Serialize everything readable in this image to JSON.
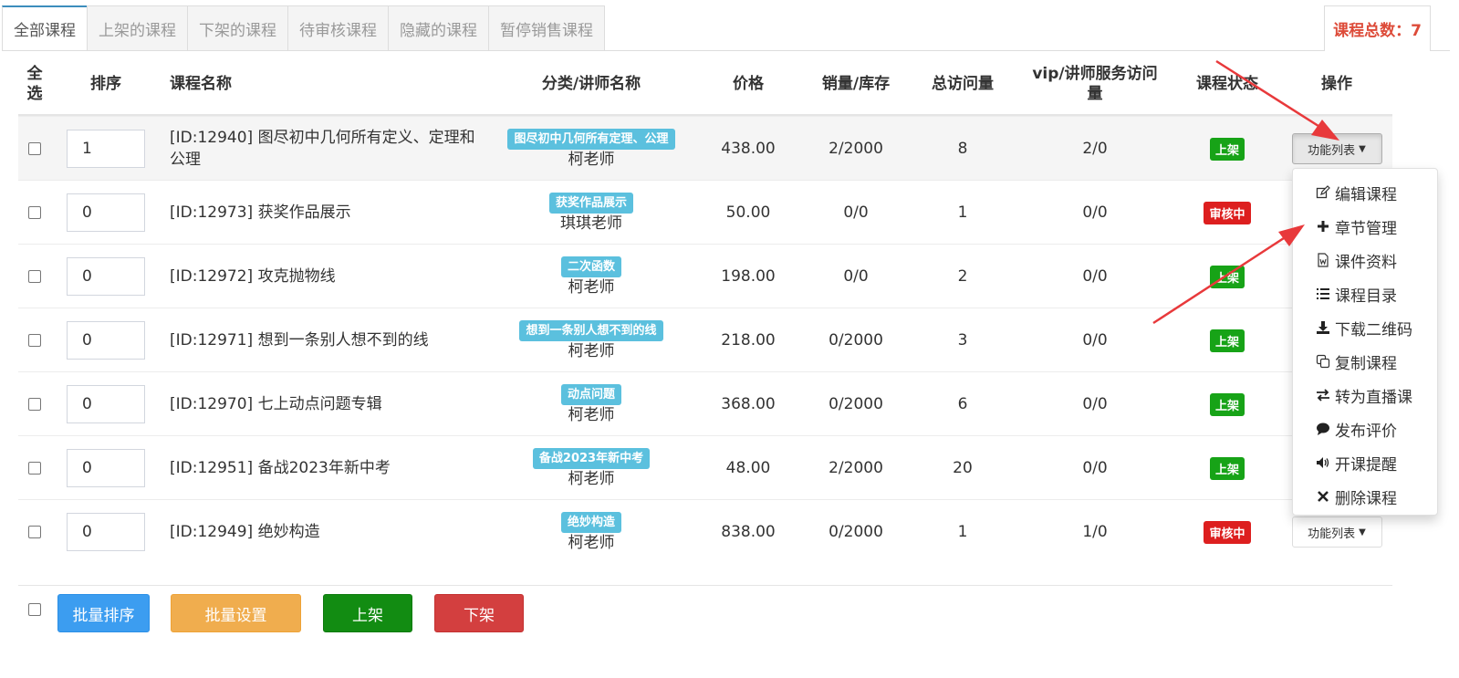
{
  "tabs": [
    "全部课程",
    "上架的课程",
    "下架的课程",
    "待审核课程",
    "隐藏的课程",
    "暂停销售课程"
  ],
  "total": {
    "label": "课程总数：7"
  },
  "headers": {
    "select_all": "全选",
    "sort": "排序",
    "name": "课程名称",
    "category": "分类/讲师名称",
    "price": "价格",
    "sales": "销量/库存",
    "visits": "总访问量",
    "vip_visits": "vip/讲师服务访问量",
    "status": "课程状态",
    "actions": "操作"
  },
  "rows": [
    {
      "sort": "1",
      "name": "[ID:12940] 图尽初中几何所有定义、定理和公理",
      "category": "图尽初中几何所有定理、公理",
      "teacher": "柯老师",
      "price": "438.00",
      "sales": "2/2000",
      "visits": "8",
      "vip": "2/0",
      "status": "上架",
      "status_color": "#17a317",
      "action": "功能列表"
    },
    {
      "sort": "0",
      "name": "[ID:12973] 获奖作品展示",
      "category": "获奖作品展示",
      "teacher": "琪琪老师",
      "price": "50.00",
      "sales": "0/0",
      "visits": "1",
      "vip": "0/0",
      "status": "审核中",
      "status_color": "#dd1f1f",
      "action": ""
    },
    {
      "sort": "0",
      "name": "[ID:12972] 攻克抛物线",
      "category": "二次函数",
      "teacher": "柯老师",
      "price": "198.00",
      "sales": "0/0",
      "visits": "2",
      "vip": "0/0",
      "status": "上架",
      "status_color": "#17a317",
      "action": ""
    },
    {
      "sort": "0",
      "name": "[ID:12971] 想到一条别人想不到的线",
      "category": "想到一条别人想不到的线",
      "teacher": "柯老师",
      "price": "218.00",
      "sales": "0/2000",
      "visits": "3",
      "vip": "0/0",
      "status": "上架",
      "status_color": "#17a317",
      "action": ""
    },
    {
      "sort": "0",
      "name": "[ID:12970] 七上动点问题专辑",
      "category": "动点问题",
      "teacher": "柯老师",
      "price": "368.00",
      "sales": "0/2000",
      "visits": "6",
      "vip": "0/0",
      "status": "上架",
      "status_color": "#17a317",
      "action": ""
    },
    {
      "sort": "0",
      "name": "[ID:12951] 备战2023年新中考",
      "category": "备战2023年新中考",
      "teacher": "柯老师",
      "price": "48.00",
      "sales": "2/2000",
      "visits": "20",
      "vip": "0/0",
      "status": "上架",
      "status_color": "#17a317",
      "action": ""
    },
    {
      "sort": "0",
      "name": "[ID:12949] 绝妙构造",
      "category": "绝妙构造",
      "teacher": "柯老师",
      "price": "838.00",
      "sales": "0/2000",
      "visits": "1",
      "vip": "1/0",
      "status": "审核中",
      "status_color": "#dd1f1f",
      "action": "功能列表"
    }
  ],
  "dropdown": [
    {
      "label": "编辑课程",
      "icon": "edit-icon"
    },
    {
      "label": "章节管理",
      "icon": "plus-icon"
    },
    {
      "label": "课件资料",
      "icon": "word-file-icon"
    },
    {
      "label": "课程目录",
      "icon": "list-icon"
    },
    {
      "label": "下载二维码",
      "icon": "download-icon"
    },
    {
      "label": "复制课程",
      "icon": "copy-icon"
    },
    {
      "label": "转为直播课",
      "icon": "exchange-icon"
    },
    {
      "label": "发布评价",
      "icon": "comment-icon"
    },
    {
      "label": "开课提醒",
      "icon": "volume-icon"
    },
    {
      "label": "删除课程",
      "icon": "close-icon"
    }
  ],
  "bottom_buttons": {
    "batch_sort": "批量排序",
    "batch_set": "批量设置",
    "on_shelf": "上架",
    "off_shelf": "下架"
  },
  "colors": {
    "annotation_arrow": "#e8393b",
    "tag": "#5bc0de"
  }
}
